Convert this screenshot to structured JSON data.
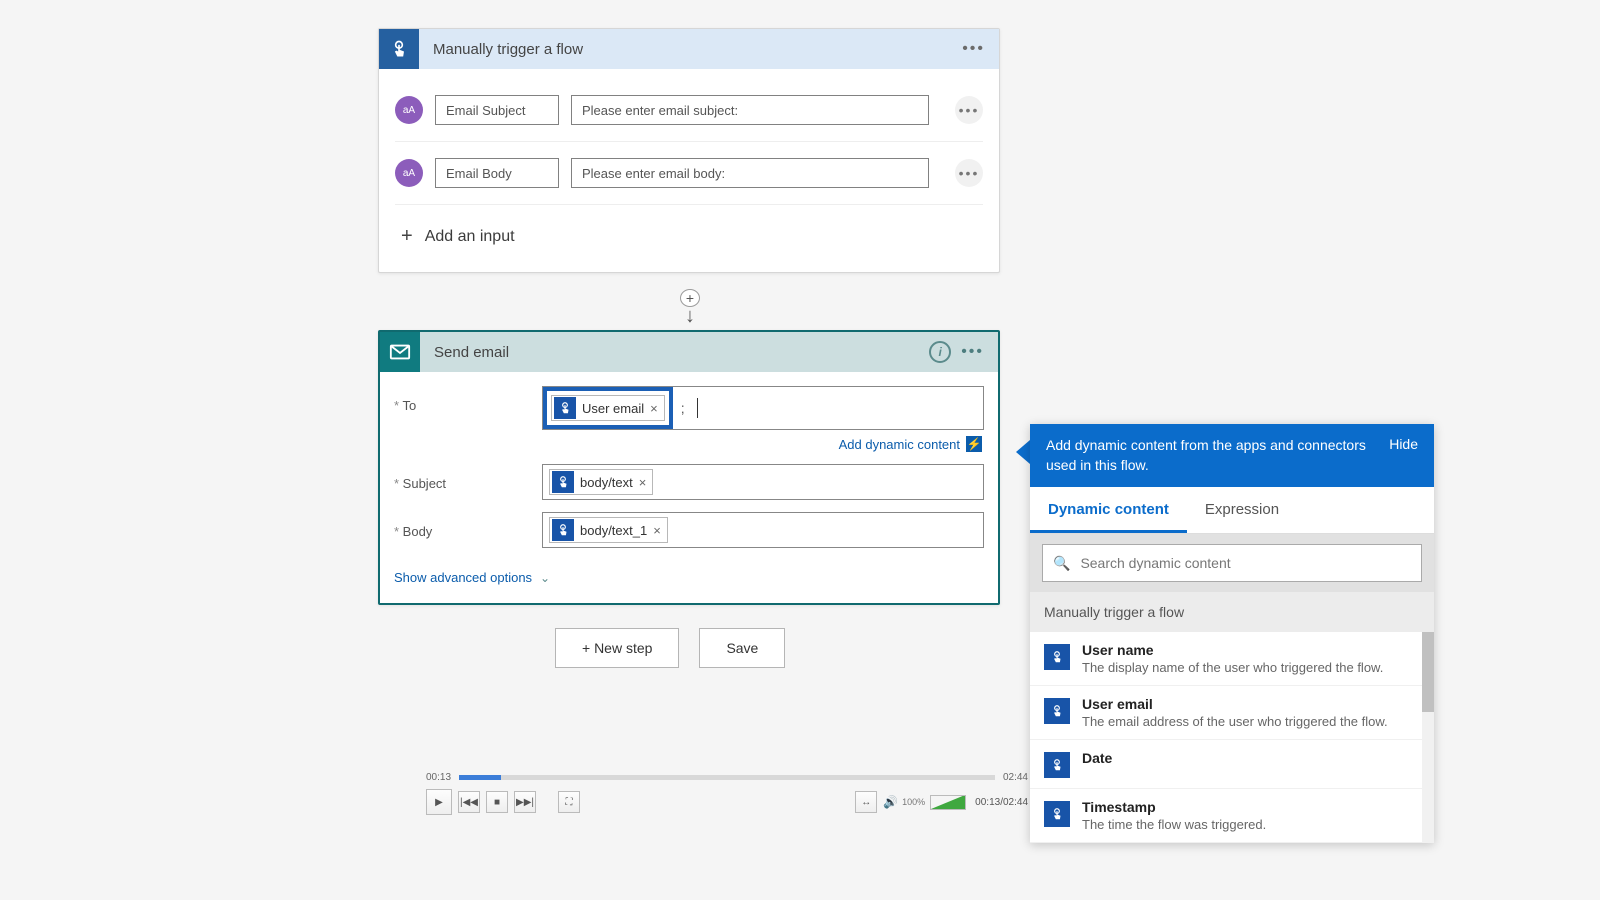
{
  "trigger": {
    "title": "Manually trigger a flow",
    "inputs": [
      {
        "badge": "aA",
        "name": "Email Subject",
        "prompt": "Please enter email subject:"
      },
      {
        "badge": "aA",
        "name": "Email Body",
        "prompt": "Please enter email body:"
      }
    ],
    "add_input_label": "Add an input"
  },
  "action": {
    "title": "Send email",
    "fields": {
      "to": {
        "label": "To",
        "token": "User email"
      },
      "subject": {
        "label": "Subject",
        "token": "body/text"
      },
      "body": {
        "label": "Body",
        "token": "body/text_1"
      }
    },
    "add_dynamic_label": "Add dynamic content",
    "show_advanced_label": "Show advanced options"
  },
  "buttons": {
    "new_step": "+ New step",
    "save": "Save"
  },
  "dynamic_panel": {
    "head_text": "Add dynamic content from the apps and connectors used in this flow.",
    "hide_label": "Hide",
    "tabs": {
      "dynamic": "Dynamic content",
      "expression": "Expression"
    },
    "search_placeholder": "Search dynamic content",
    "group_title": "Manually trigger a flow",
    "items": [
      {
        "title": "User name",
        "desc": "The display name of the user who triggered the flow."
      },
      {
        "title": "User email",
        "desc": "The email address of the user who triggered the flow."
      },
      {
        "title": "Date",
        "desc": ""
      },
      {
        "title": "Timestamp",
        "desc": "The time the flow was triggered."
      }
    ]
  },
  "player": {
    "elapsed_short": "00:13",
    "total_short": "02:44",
    "combo": "00:13/02:44",
    "volume_pct": "100%"
  }
}
